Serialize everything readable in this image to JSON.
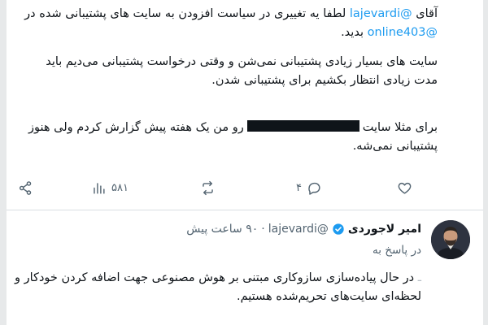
{
  "tweet": {
    "p1": {
      "part1": "آقای",
      "mention1": "@lajevardi",
      "part2": "لطفا یه تغییری در سیاست افزودن به سایت های پشتیبانی شده در",
      "mention2": "@online403",
      "part3": "بدید."
    },
    "p2": "سایت های بسیار زیادی پشتیبانی نمی‌شن و وقتی درخواست پشتیبانی می‌دیم باید مدت زیادی انتظار بکشیم برای پشتیبانی شدن.",
    "p3": {
      "before": "برای مثلا سایت",
      "after": "رو من یک هفته پیش گزارش کردم ولی هنوز پشتیبانی نمی‌شه."
    },
    "stats": {
      "replies": "۴",
      "views": "۵۸۱"
    }
  },
  "reply": {
    "name": "امیر لاجوردی",
    "handle": "@lajevardi",
    "separator": "·",
    "time": "۹۰ ساعت پیش",
    "reply_to_label": "در پاسخ به",
    "body_faint": "ـ",
    "body": "در حال پیاده‌سازی سازوکاری مبتنی بر هوش مصنوعی جهت اضافه کردن خودکار و لحظه‌ای سایت‌های تحریم‌شده هستیم."
  },
  "icons": {
    "share": "share-icon",
    "views": "bar-chart-icon",
    "retweet": "retweet-icon",
    "reply": "reply-icon",
    "like": "heart-icon",
    "verified": "verified-badge-icon"
  },
  "colors": {
    "accent": "#1d9bf0",
    "text": "#0f1419",
    "muted": "#536471"
  }
}
